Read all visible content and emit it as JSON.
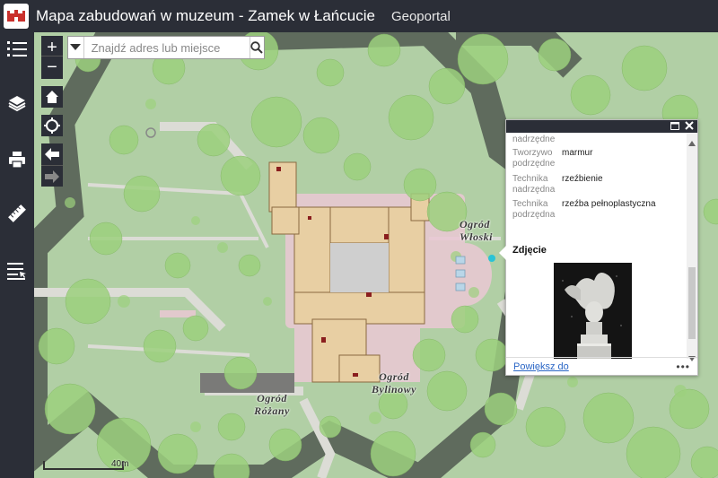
{
  "header": {
    "title": "Mapa zabudowań w muzeum - Zamek w Łańcucie",
    "subtitle": "Geoportal",
    "logo_icon": "castle-logo"
  },
  "sidebar": {
    "items": [
      {
        "icon": "legend-list-icon"
      },
      {
        "icon": "layers-icon"
      },
      {
        "icon": "print-icon"
      },
      {
        "icon": "measure-icon"
      },
      {
        "icon": "select-icon"
      }
    ]
  },
  "map": {
    "zoom_in": "+",
    "zoom_out": "−",
    "search": {
      "placeholder": "Znajdź adres lub miejsce",
      "value": ""
    },
    "labels": {
      "ogrod_wloski": "Ogród Włoski",
      "ogrod_bylinowy": "Ogród Bylinowy",
      "ogrod_rozany": "Ogród Różany"
    },
    "scale": "40m",
    "colors": {
      "tree_canopy": "#9dd17e",
      "building": "#e8cfa3",
      "fortification": "#5f6b5d",
      "path": "#dcdcd6",
      "lawn": "#b4d0a8"
    }
  },
  "popup": {
    "attributes": [
      {
        "key": "Tworzywo nadrzędne",
        "value": ""
      },
      {
        "key": "Tworzywo podrzędne",
        "value": "marmur"
      },
      {
        "key": "Technika nadrzędna",
        "value": "rzeźbienie"
      },
      {
        "key": "Technika podrzędna",
        "value": "rzeźba pełnoplastyczna"
      }
    ],
    "photo_heading": "Zdjęcie",
    "zoom_link": "Powiększ do",
    "more": "•••"
  }
}
